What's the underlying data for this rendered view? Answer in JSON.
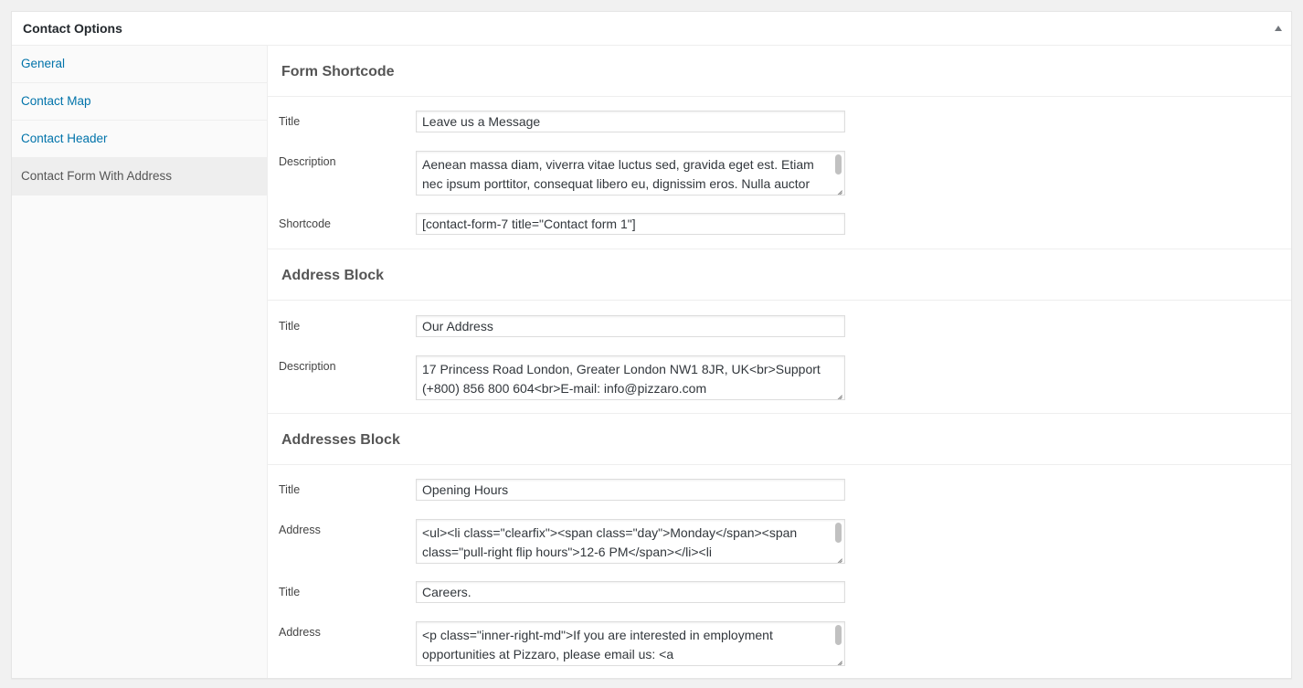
{
  "panel": {
    "title": "Contact Options"
  },
  "sidebar": {
    "items": [
      {
        "label": "General"
      },
      {
        "label": "Contact Map"
      },
      {
        "label": "Contact Header"
      },
      {
        "label": "Contact Form With Address"
      }
    ]
  },
  "form_shortcode": {
    "heading": "Form Shortcode",
    "title_label": "Title",
    "title_value": "Leave us a Message",
    "description_label": "Description",
    "description_value": "Aenean massa diam, viverra vitae luctus sed, gravida eget est. Etiam nec ipsum porttitor, consequat libero eu, dignissim eros. Nulla auctor",
    "shortcode_label": "Shortcode",
    "shortcode_value": "[contact-form-7 title=\"Contact form 1\"]"
  },
  "address_block": {
    "heading": "Address Block",
    "title_label": "Title",
    "title_value": "Our Address",
    "description_label": "Description",
    "description_value": "17 Princess Road London, Greater London NW1 8JR, UK<br>Support (+800) 856 800 604<br>E-mail: info@pizzaro.com"
  },
  "addresses_block": {
    "heading": "Addresses Block",
    "entries": [
      {
        "title_label": "Title",
        "title_value": "Opening Hours",
        "address_label": "Address",
        "address_value": "<ul><li class=\"clearfix\"><span class=\"day\">Monday</span><span class=\"pull-right flip hours\">12-6 PM</span></li><li"
      },
      {
        "title_label": "Title",
        "title_value": "Careers.",
        "address_label": "Address",
        "address_value": "<p class=\"inner-right-md\">If you are interested in employment opportunities at Pizzaro, please email us: <a"
      }
    ]
  }
}
